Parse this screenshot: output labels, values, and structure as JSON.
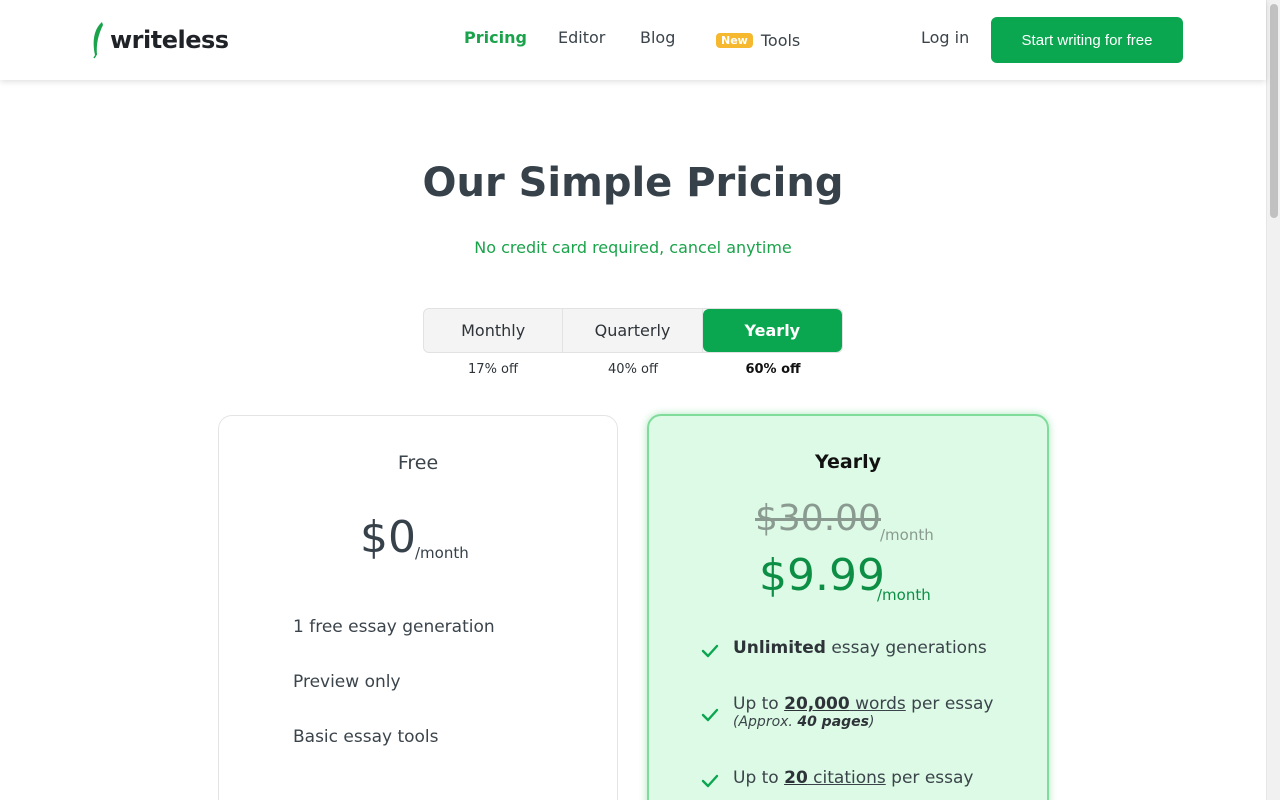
{
  "header": {
    "brand": "writeless",
    "nav": {
      "pricing": "Pricing",
      "editor": "Editor",
      "blog": "Blog",
      "tools_badge": "New",
      "tools": "Tools"
    },
    "login": "Log in",
    "cta": "Start writing for free"
  },
  "hero": {
    "title": "Our Simple Pricing",
    "subtitle": "No credit card required, cancel anytime"
  },
  "billing": {
    "options": [
      "Monthly",
      "Quarterly",
      "Yearly"
    ],
    "selected": "Yearly",
    "discounts": [
      "17% off",
      "40% off",
      "60% off"
    ]
  },
  "plans": {
    "free": {
      "name": "Free",
      "price": "$0",
      "period": "/month",
      "features": [
        "1 free essay generation",
        "Preview only",
        "Basic essay tools"
      ]
    },
    "yearly": {
      "name": "Yearly",
      "old_price": "$30.00",
      "old_period": "/month",
      "price": "$9.99",
      "period": "/month",
      "f1_bold": "Unlimited",
      "f1_rest": " essay generations",
      "f2_pre": "Up to ",
      "f2_num": "20,000",
      "f2_word": " words",
      "f2_post": " per essay",
      "f2_approx_pre": "(Approx. ",
      "f2_approx_num": "40 pages",
      "f2_approx_post": ")",
      "f3_pre": "Up to ",
      "f3_num": "20",
      "f3_word": " citations",
      "f3_post": " per essay"
    }
  },
  "colors": {
    "brand_green": "#0aa650",
    "accent_text_green": "#1aa34a",
    "badge_yellow": "#f5b82e",
    "card_highlight_bg": "#dcfae5"
  },
  "icons": [
    "feather-logo-icon",
    "check-icon"
  ]
}
